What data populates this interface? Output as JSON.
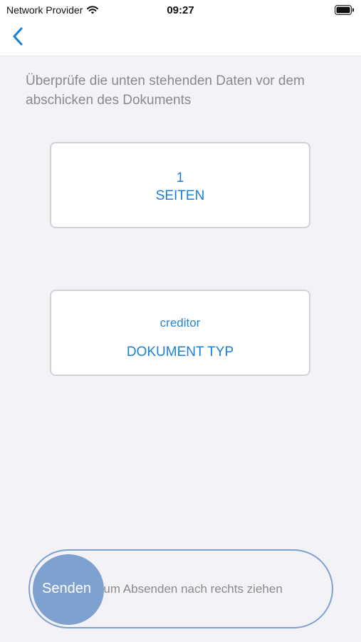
{
  "status_bar": {
    "carrier": "Network Provider",
    "time": "09:27",
    "wifi_icon": "wifi-icon",
    "battery_icon": "battery-icon"
  },
  "nav": {
    "back_icon": "chevron-left-icon"
  },
  "instruction": "Überprüfe die unten stehenden Daten vor dem abschicken des Dokuments",
  "cards": {
    "pages": {
      "value": "1",
      "label": "SEITEN"
    },
    "doctype": {
      "value": "creditor",
      "label": "DOKUMENT TYP"
    }
  },
  "slider": {
    "knob_label": "Senden",
    "hint": "Zum Absenden nach rechts ziehen"
  },
  "colors": {
    "accent": "#1a7fd6",
    "slider": "#7fa1d0",
    "background": "#f2f2f7"
  }
}
